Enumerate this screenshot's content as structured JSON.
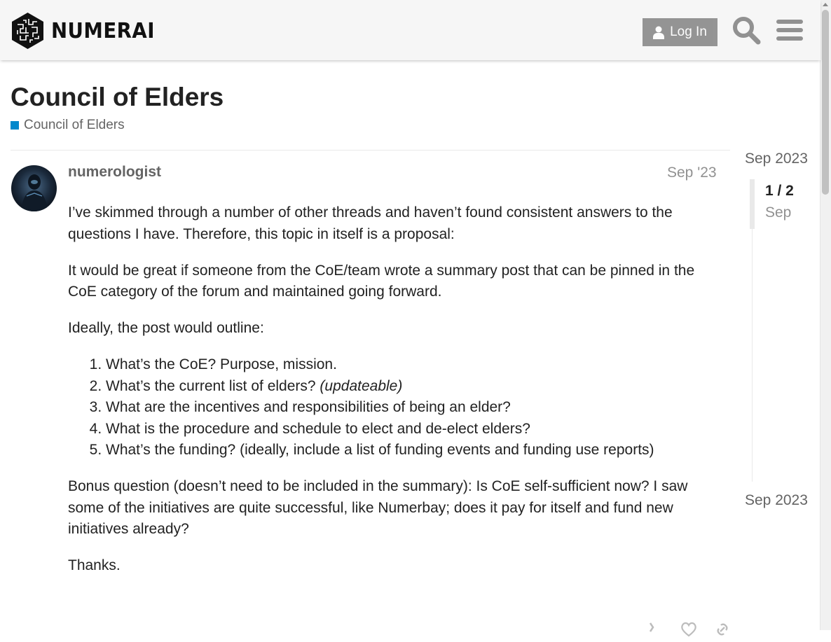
{
  "header": {
    "logo_text": "NUMERAI",
    "login_label": "Log In",
    "icons": [
      "user-icon",
      "search-icon",
      "hamburger-menu-icon"
    ]
  },
  "topic": {
    "title": "Council of Elders",
    "category": "Council of Elders",
    "category_color": "#0088cc"
  },
  "post": {
    "username": "numerologist",
    "date": "Sep '23",
    "paragraphs_before": [
      "I’ve skimmed through a number of other threads and haven’t found consistent answers to the questions I have. Therefore, this topic in itself is a proposal:",
      "It would be great if someone from the CoE/team wrote a summary post that can be pinned in the CoE category of the forum and maintained going forward.",
      "Ideally, the post would outline:"
    ],
    "list": [
      {
        "text": "What’s the CoE? Purpose, mission.",
        "emphasis": ""
      },
      {
        "text": "What’s the current list of elders? ",
        "emphasis": "(updateable)"
      },
      {
        "text": "What are the incentives and responsibilities of being an elder?",
        "emphasis": ""
      },
      {
        "text": "What is the procedure and schedule to elect and de-elect elders?",
        "emphasis": ""
      },
      {
        "text": "What’s the funding? (ideally, include a list of funding events and funding use reports)",
        "emphasis": ""
      }
    ],
    "paragraphs_after": [
      "Bonus question (doesn’t need to be included in the summary): Is CoE self-sufficient now? I saw some of the initiatives are quite successful, like Numerbay; does it pay for itself and fund new initiatives already?",
      "Thanks."
    ],
    "action_icons": [
      "like-count-icon",
      "heart-icon",
      "link-icon"
    ]
  },
  "timeline": {
    "start": "Sep 2023",
    "counter": "1 / 2",
    "current_month": "Sep",
    "end": "Sep 2023"
  },
  "colors": {
    "header_bg": "#f6f6f6",
    "button_bg": "#6f6f6f",
    "text_primary": "#222222",
    "text_muted": "#646464",
    "text_light": "#919191"
  }
}
